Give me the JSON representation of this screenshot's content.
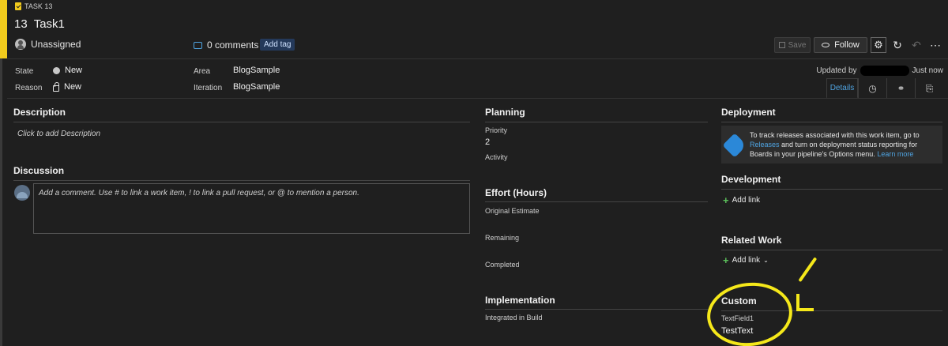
{
  "colors": {
    "accent": "#f2cb1d",
    "link": "#4fa3e0",
    "tag_bg": "#24395a",
    "highlight": "#f5e81a"
  },
  "work_item": {
    "type_label": "TASK 13",
    "id": "13",
    "title": "Task1",
    "assigned": "Unassigned",
    "comments": "0 comments",
    "add_tag": "Add tag"
  },
  "toolbar": {
    "save": "Save",
    "follow": "Follow",
    "icons": [
      "gear-icon",
      "refresh-icon",
      "undo-icon",
      "more-icon"
    ]
  },
  "fields": {
    "state_label": "State",
    "state_value": "New",
    "reason_label": "Reason",
    "reason_value": "New",
    "area_label": "Area",
    "area_value": "BlogSample",
    "iteration_label": "Iteration",
    "iteration_value": "BlogSample"
  },
  "updated": {
    "prefix": "Updated by",
    "time": "Just now"
  },
  "tabs": {
    "details": "Details",
    "icons": [
      "history-icon",
      "link-icon",
      "attachment-icon"
    ]
  },
  "description": {
    "title": "Description",
    "placeholder": "Click to add Description"
  },
  "discussion": {
    "title": "Discussion",
    "placeholder": "Add a comment. Use # to link a work item, ! to link a pull request, or @ to mention a person."
  },
  "planning": {
    "title": "Planning",
    "priority_label": "Priority",
    "priority_value": "2",
    "activity_label": "Activity"
  },
  "effort": {
    "title": "Effort (Hours)",
    "original": "Original Estimate",
    "remaining": "Remaining",
    "completed": "Completed"
  },
  "implementation": {
    "title": "Implementation",
    "integrated": "Integrated in Build"
  },
  "deployment": {
    "title": "Deployment",
    "text_1": "To track releases associated with this work item, go to",
    "releases_link": "Releases",
    "text_2": " and turn on deployment status reporting for Boards in your pipeline's Options menu.",
    "learn_more": "Learn more"
  },
  "development": {
    "title": "Development",
    "add_link": "Add link"
  },
  "related": {
    "title": "Related Work",
    "add_link": "Add link"
  },
  "custom": {
    "title": "Custom",
    "field_label": "TextField1",
    "field_value": "TestText"
  }
}
